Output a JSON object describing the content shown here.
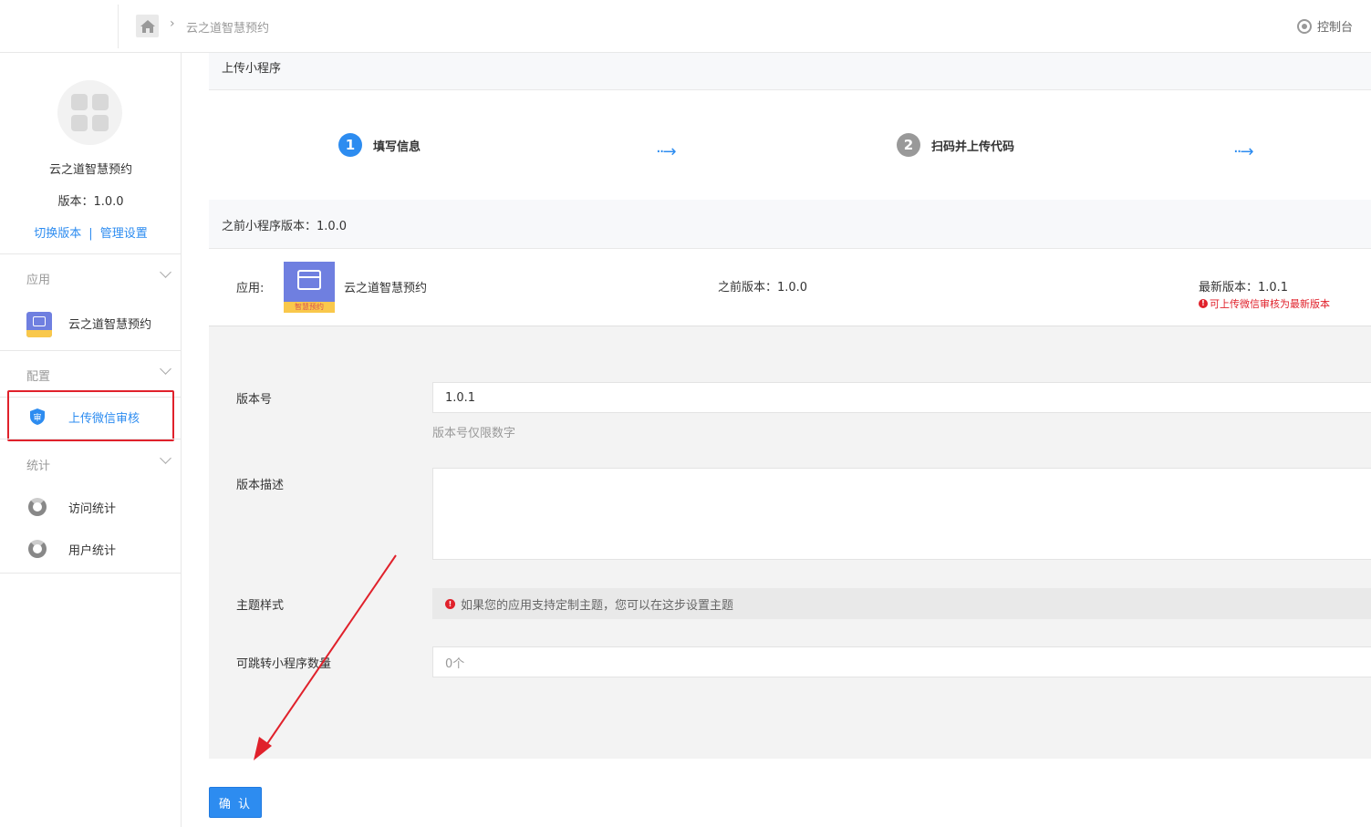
{
  "header": {
    "breadcrumb_current": "云之道智慧预约",
    "console_label": "控制台"
  },
  "sidebar": {
    "app_name": "云之道智慧预约",
    "version_text": "版本：1.0.0",
    "switch_version": "切换版本",
    "link_divider": "|",
    "manage_settings": "管理设置",
    "groups": [
      {
        "title": "应用",
        "items": [
          {
            "label": "云之道智慧预约"
          }
        ]
      },
      {
        "title": "配置",
        "items": [
          {
            "label": "上传微信审核"
          }
        ]
      },
      {
        "title": "统计",
        "items": [
          {
            "label": "访问统计"
          },
          {
            "label": "用户统计"
          }
        ]
      }
    ]
  },
  "main": {
    "panel_title": "上传小程序",
    "steps": [
      {
        "num": "1",
        "label": "填写信息"
      },
      {
        "num": "2",
        "label": "扫码并上传代码"
      }
    ],
    "step_arrow": "··→",
    "prev_version_title": "之前小程序版本：1.0.0",
    "app_row": {
      "app_label": "应用:",
      "icon_band_text": "智慧预约",
      "app_name": "云之道智慧预约",
      "prev_version": "之前版本：1.0.0",
      "latest_version": "最新版本：1.0.1",
      "notice_mark": "!",
      "notice": "可上传微信审核为最新版本"
    },
    "form": {
      "version_label": "版本号",
      "version_value": "1.0.1",
      "version_hint": "版本号仅限数字",
      "desc_label": "版本描述",
      "theme_label": "主题样式",
      "theme_notice_mark": "!",
      "theme_notice": "如果您的应用支持定制主题，您可以在这步设置主题",
      "jump_label": "可跳转小程序数量",
      "jump_value": "0个"
    },
    "confirm_label": "确 认"
  },
  "colors": {
    "accent": "#2d8cf0",
    "danger": "#e0212b",
    "form_bg": "#f3f3f3"
  }
}
